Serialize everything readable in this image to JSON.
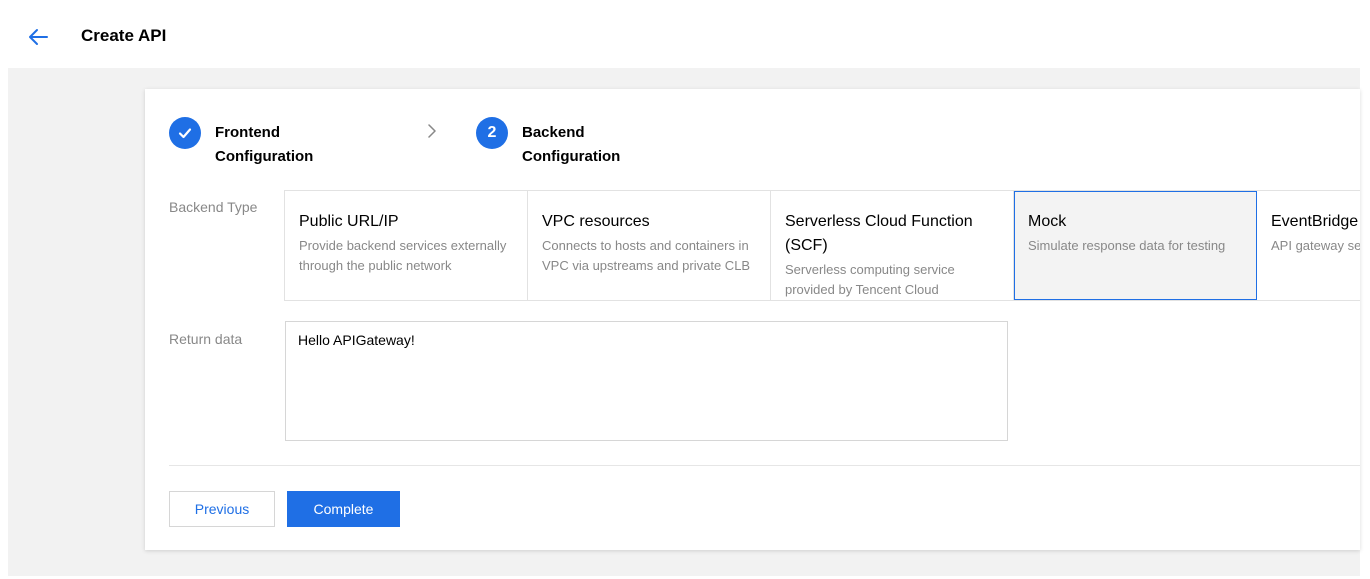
{
  "header": {
    "title": "Create API"
  },
  "steps": [
    {
      "label": "Frontend Configuration",
      "status": "done",
      "icon": "check-icon"
    },
    {
      "label": "Backend Configuration",
      "status": "current",
      "number": "2"
    }
  ],
  "form": {
    "backend_type_label": "Backend Type",
    "backend_types": [
      {
        "title": "Public URL/IP",
        "desc": "Provide backend services externally through the public network"
      },
      {
        "title": "VPC resources",
        "desc": "Connects to hosts and containers in VPC via upstreams and private CLB"
      },
      {
        "title": "Serverless Cloud Function (SCF)",
        "desc": "Serverless computing service provided by Tencent Cloud"
      },
      {
        "title": "Mock",
        "desc": "Simulate response data for testing",
        "selected": true
      },
      {
        "title": "EventBridge",
        "desc": "API gateway set entry"
      }
    ],
    "return_data_label": "Return data",
    "return_data_value": "Hello APIGateway!"
  },
  "buttons": {
    "previous": "Previous",
    "complete": "Complete"
  },
  "colors": {
    "accent": "#1f6fe5",
    "background": "#f2f2f2"
  }
}
